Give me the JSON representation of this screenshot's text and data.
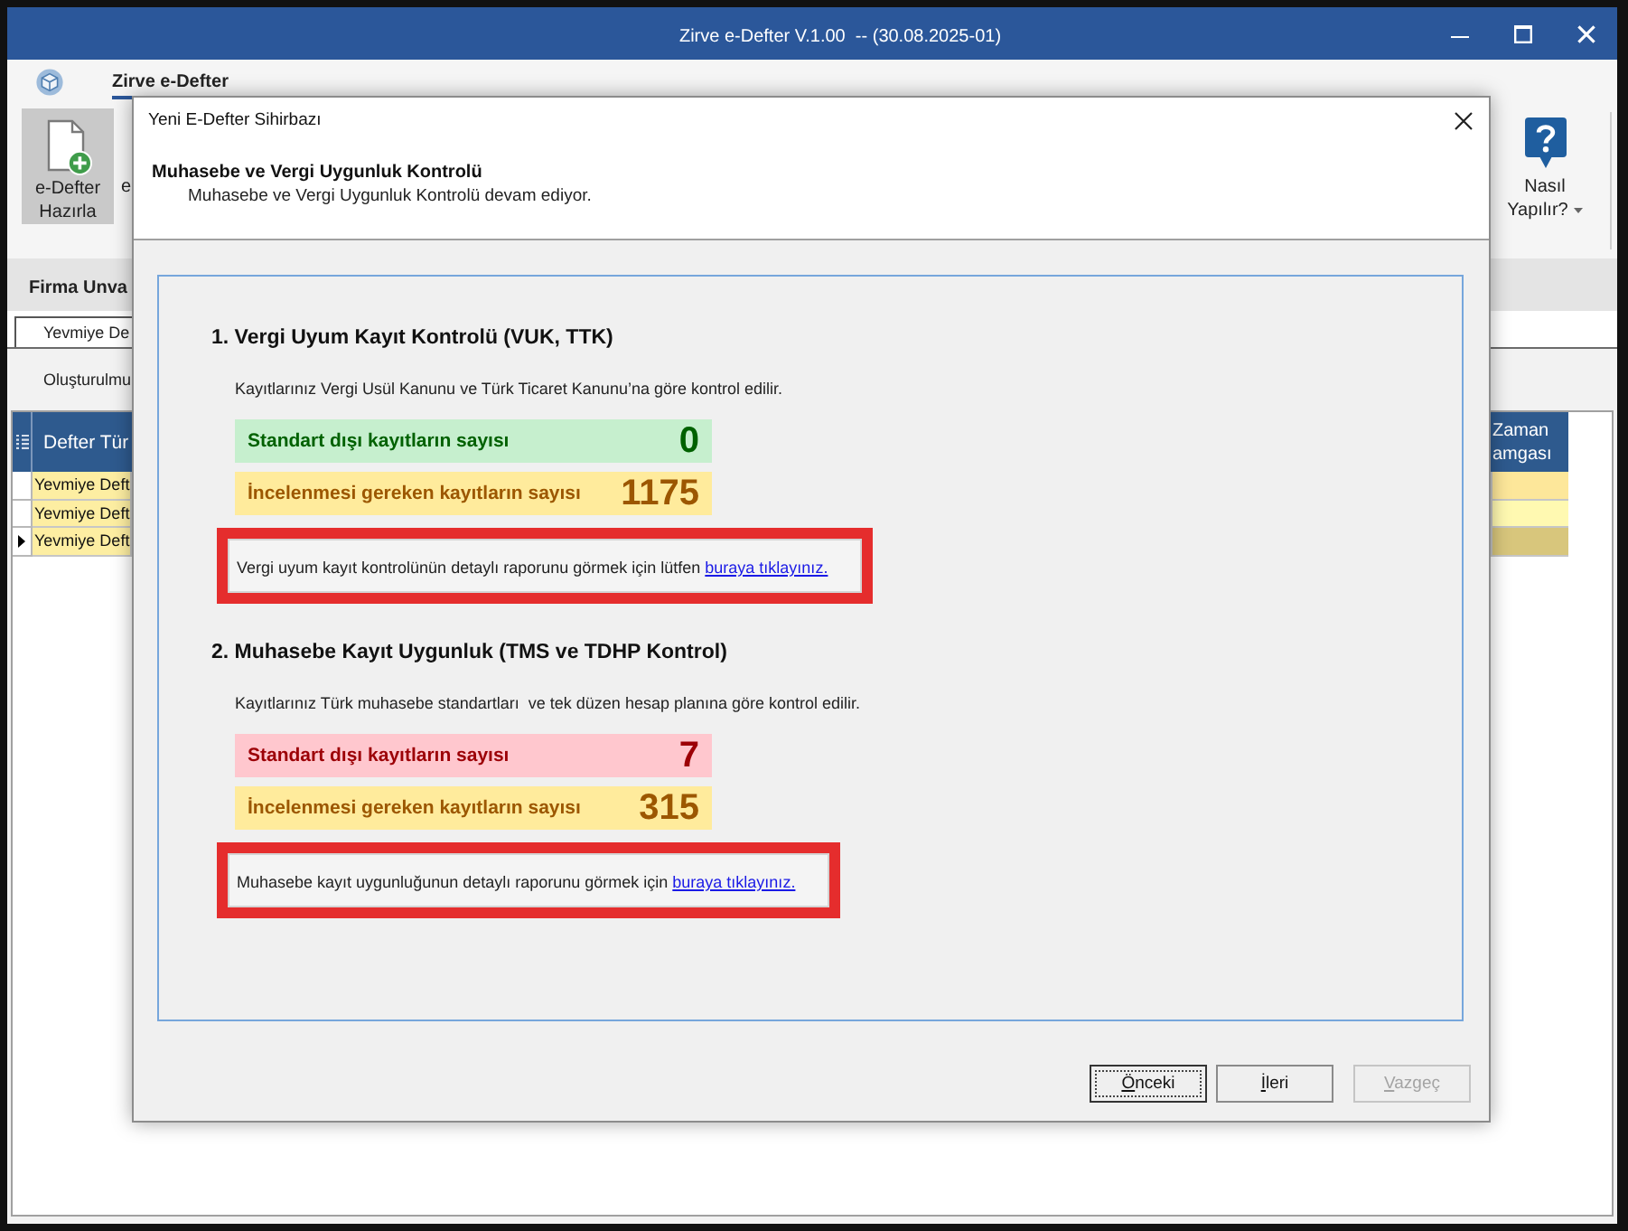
{
  "window": {
    "title": "Zirve e-Defter V.1.00  -- (30.08.2025-01)"
  },
  "ribbon": {
    "tab": {
      "label": "Zirve e-Defter",
      "selected": true
    },
    "buttons": [
      {
        "label": "e-Defter Hazırla",
        "kind": "new-document",
        "selected": true
      },
      {
        "label": "e",
        "kind": "clipped",
        "selected": false
      }
    ],
    "help": {
      "label": "Nasıl Yapılır?"
    }
  },
  "firm_bar": {
    "label": "Firma Unva"
  },
  "document_tab": {
    "label": "Yevmiye De",
    "selected": true
  },
  "toolbar": {
    "label": "Oluşturulmu"
  },
  "grid": {
    "columns": [
      "Defter Tür",
      "Zaman amgası"
    ],
    "rows": [
      {
        "cells": [
          "Yevmiye Deft"
        ],
        "selected": false
      },
      {
        "cells": [
          "Yevmiye Deft"
        ],
        "selected": false
      },
      {
        "cells": [
          "Yevmiye Deft"
        ],
        "selected": true
      }
    ]
  },
  "dialog": {
    "title": "Yeni E-Defter Sihirbazı",
    "step_title": "Muhasebe ve Vergi Uygunluk Kontrolü",
    "step_description": "Muhasebe ve Vergi Uygunluk Kontrolü devam ediyor.",
    "sections": [
      {
        "heading": "1. Vergi Uyum Kayıt Kontrolü (VUK, TTK)",
        "description": "Kayıtlarınız Vergi Usül Kanunu ve Türk Ticaret Kanunu’na göre kontrol edilir.",
        "stats": [
          {
            "label": "Standart dışı kayıtların sayısı",
            "value": "0",
            "kind": "success"
          },
          {
            "label": "İncelenmesi gereken kayıtların sayısı",
            "value": "1175",
            "kind": "warning"
          }
        ],
        "report": {
          "text": "Vergi uyum kayıt kontrolünün detaylı raporunu görmek için lütfen",
          "link": "buraya tıklayınız."
        }
      },
      {
        "heading": "2. Muhasebe Kayıt Uygunluk (TMS ve TDHP Kontrol)",
        "description": "Kayıtlarınız Türk muhasebe standartları  ve tek düzen hesap planına göre kontrol edilir.",
        "stats": [
          {
            "label": "Standart dışı kayıtların sayısı",
            "value": "7",
            "kind": "danger"
          },
          {
            "label": "İncelenmesi gereken kayıtların sayısı",
            "value": "315",
            "kind": "warning"
          }
        ],
        "report": {
          "text": "Muhasebe kayıt uygunluğunun detaylı raporunu görmek için",
          "link": "buraya tıklayınız."
        }
      }
    ],
    "buttons": [
      {
        "label": "Önceki",
        "focused": true,
        "disabled": false
      },
      {
        "label": "İleri",
        "focused": false,
        "disabled": false
      },
      {
        "label": "Vazgeç",
        "focused": false,
        "disabled": true
      }
    ]
  }
}
